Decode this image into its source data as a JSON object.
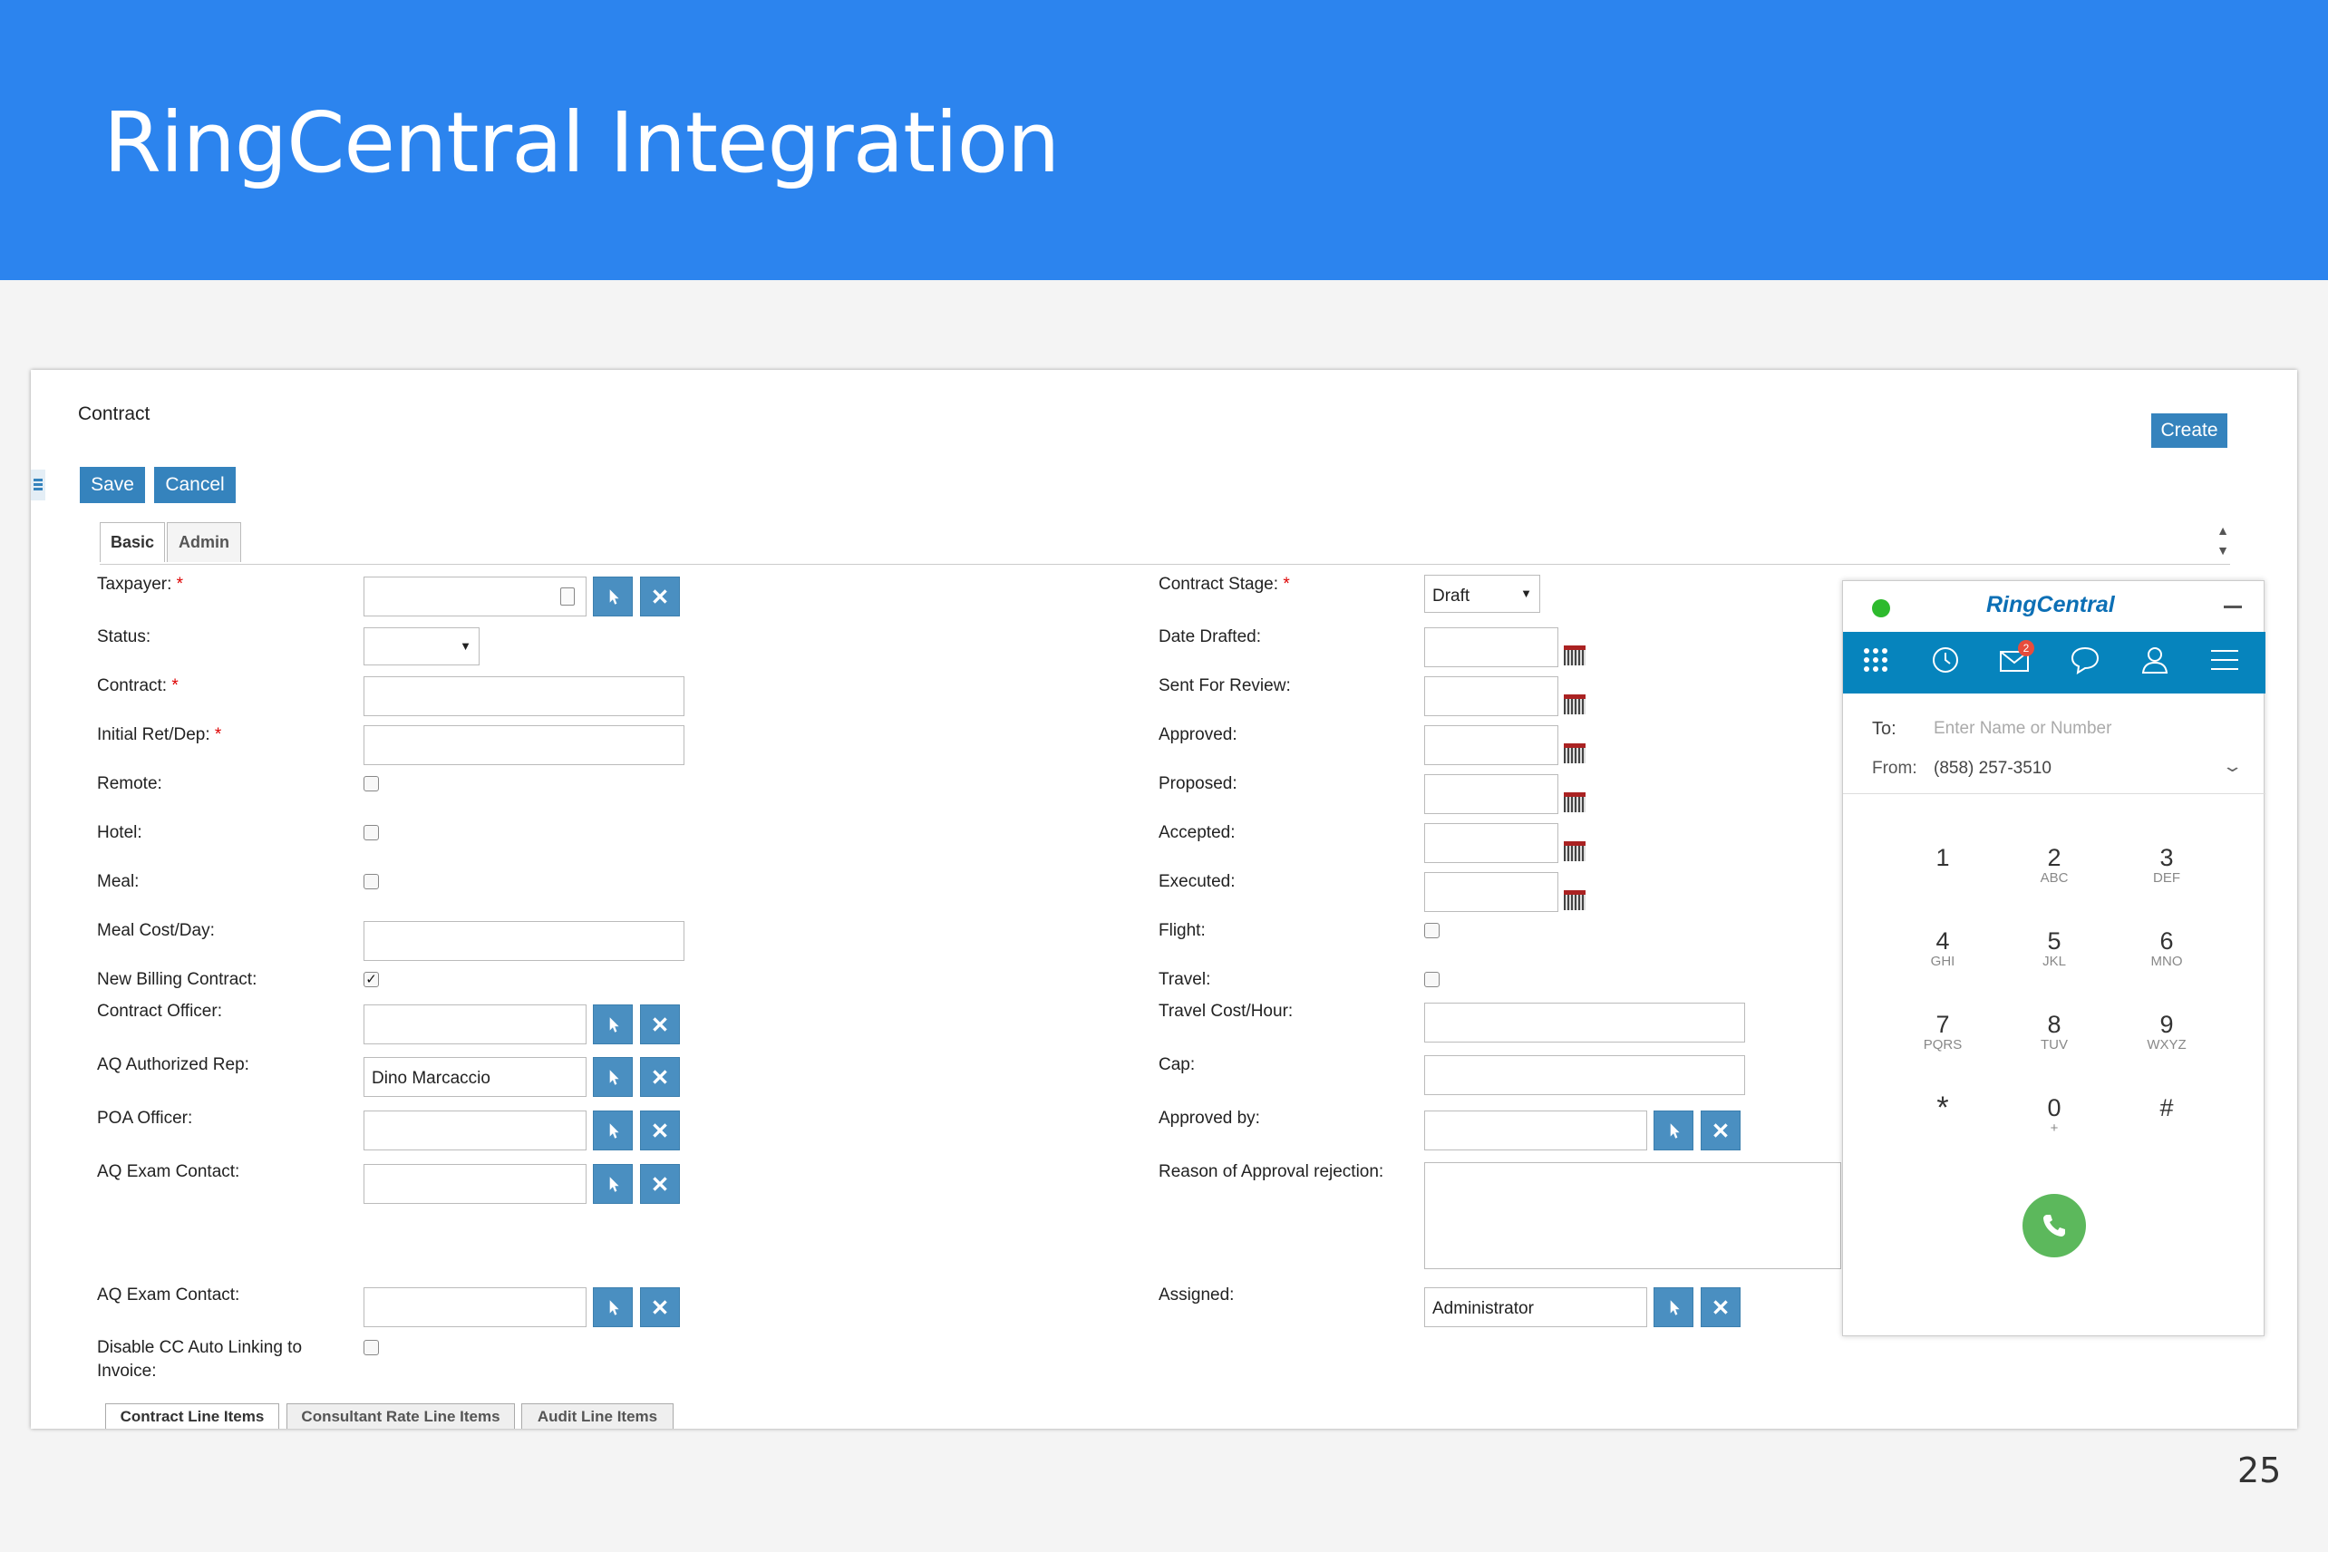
{
  "slide": {
    "title": "RingCentral Integration",
    "page_number": "25"
  },
  "form": {
    "heading": "Contract",
    "create_label": "Create",
    "save_label": "Save",
    "cancel_label": "Cancel",
    "tabs": [
      "Basic",
      "Admin"
    ],
    "left_labels": {
      "taxpayer": "Taxpayer:",
      "status": "Status:",
      "contract": "Contract:",
      "initial_ret_dep": "Initial Ret/Dep:",
      "remote": "Remote:",
      "hotel": "Hotel:",
      "meal": "Meal:",
      "meal_cost_day": "Meal Cost/Day:",
      "new_billing_contract": "New Billing Contract:",
      "contract_officer": "Contract Officer:",
      "aq_authorized_rep": "AQ Authorized Rep:",
      "poa_officer": "POA Officer:",
      "aq_exam_contact_1": "AQ Exam Contact:",
      "aq_exam_contact_2": "AQ Exam Contact:",
      "disable_cc_line1": "Disable CC Auto Linking to",
      "disable_cc_line2": "Invoice:"
    },
    "right_labels": {
      "contract_stage": "Contract Stage:",
      "date_drafted": "Date Drafted:",
      "sent_for_review": "Sent For Review:",
      "approved": "Approved:",
      "proposed": "Proposed:",
      "accepted": "Accepted:",
      "executed": "Executed:",
      "flight": "Flight:",
      "travel": "Travel:",
      "travel_cost_hour": "Travel Cost/Hour:",
      "cap": "Cap:",
      "approved_by": "Approved by:",
      "reason_rejection": "Reason of Approval rejection:",
      "assigned": "Assigned:"
    },
    "required_mark": "*",
    "values": {
      "aq_authorized_rep": "Dino Marcaccio",
      "contract_stage": "Draft",
      "assigned": "Administrator",
      "new_billing_contract_checked": true
    },
    "bottom_tabs": [
      "Contract Line Items",
      "Consultant Rate Line Items",
      "Audit Line Items"
    ]
  },
  "ringcentral": {
    "brand": "RingCentral",
    "badge_count": "2",
    "to_label": "To:",
    "to_placeholder": "Enter Name or Number",
    "from_label": "From:",
    "from_value": "(858) 257-3510",
    "keys": [
      {
        "digit": "1",
        "letters": ""
      },
      {
        "digit": "2",
        "letters": "ABC"
      },
      {
        "digit": "3",
        "letters": "DEF"
      },
      {
        "digit": "4",
        "letters": "GHI"
      },
      {
        "digit": "5",
        "letters": "JKL"
      },
      {
        "digit": "6",
        "letters": "MNO"
      },
      {
        "digit": "7",
        "letters": "PQRS"
      },
      {
        "digit": "8",
        "letters": "TUV"
      },
      {
        "digit": "9",
        "letters": "WXYZ"
      },
      {
        "digit": "*",
        "letters": ""
      },
      {
        "digit": "0",
        "letters": "+"
      },
      {
        "digit": "#",
        "letters": ""
      }
    ],
    "colors": {
      "brand_orange": "#f58220",
      "brand_blue": "#0c6fb5",
      "nav_bar": "#0684bd",
      "call_green": "#5cb85c",
      "status_dot": "#2dba2d"
    }
  },
  "colors": {
    "banner": "#2c84ee",
    "button": "#3583bd"
  }
}
